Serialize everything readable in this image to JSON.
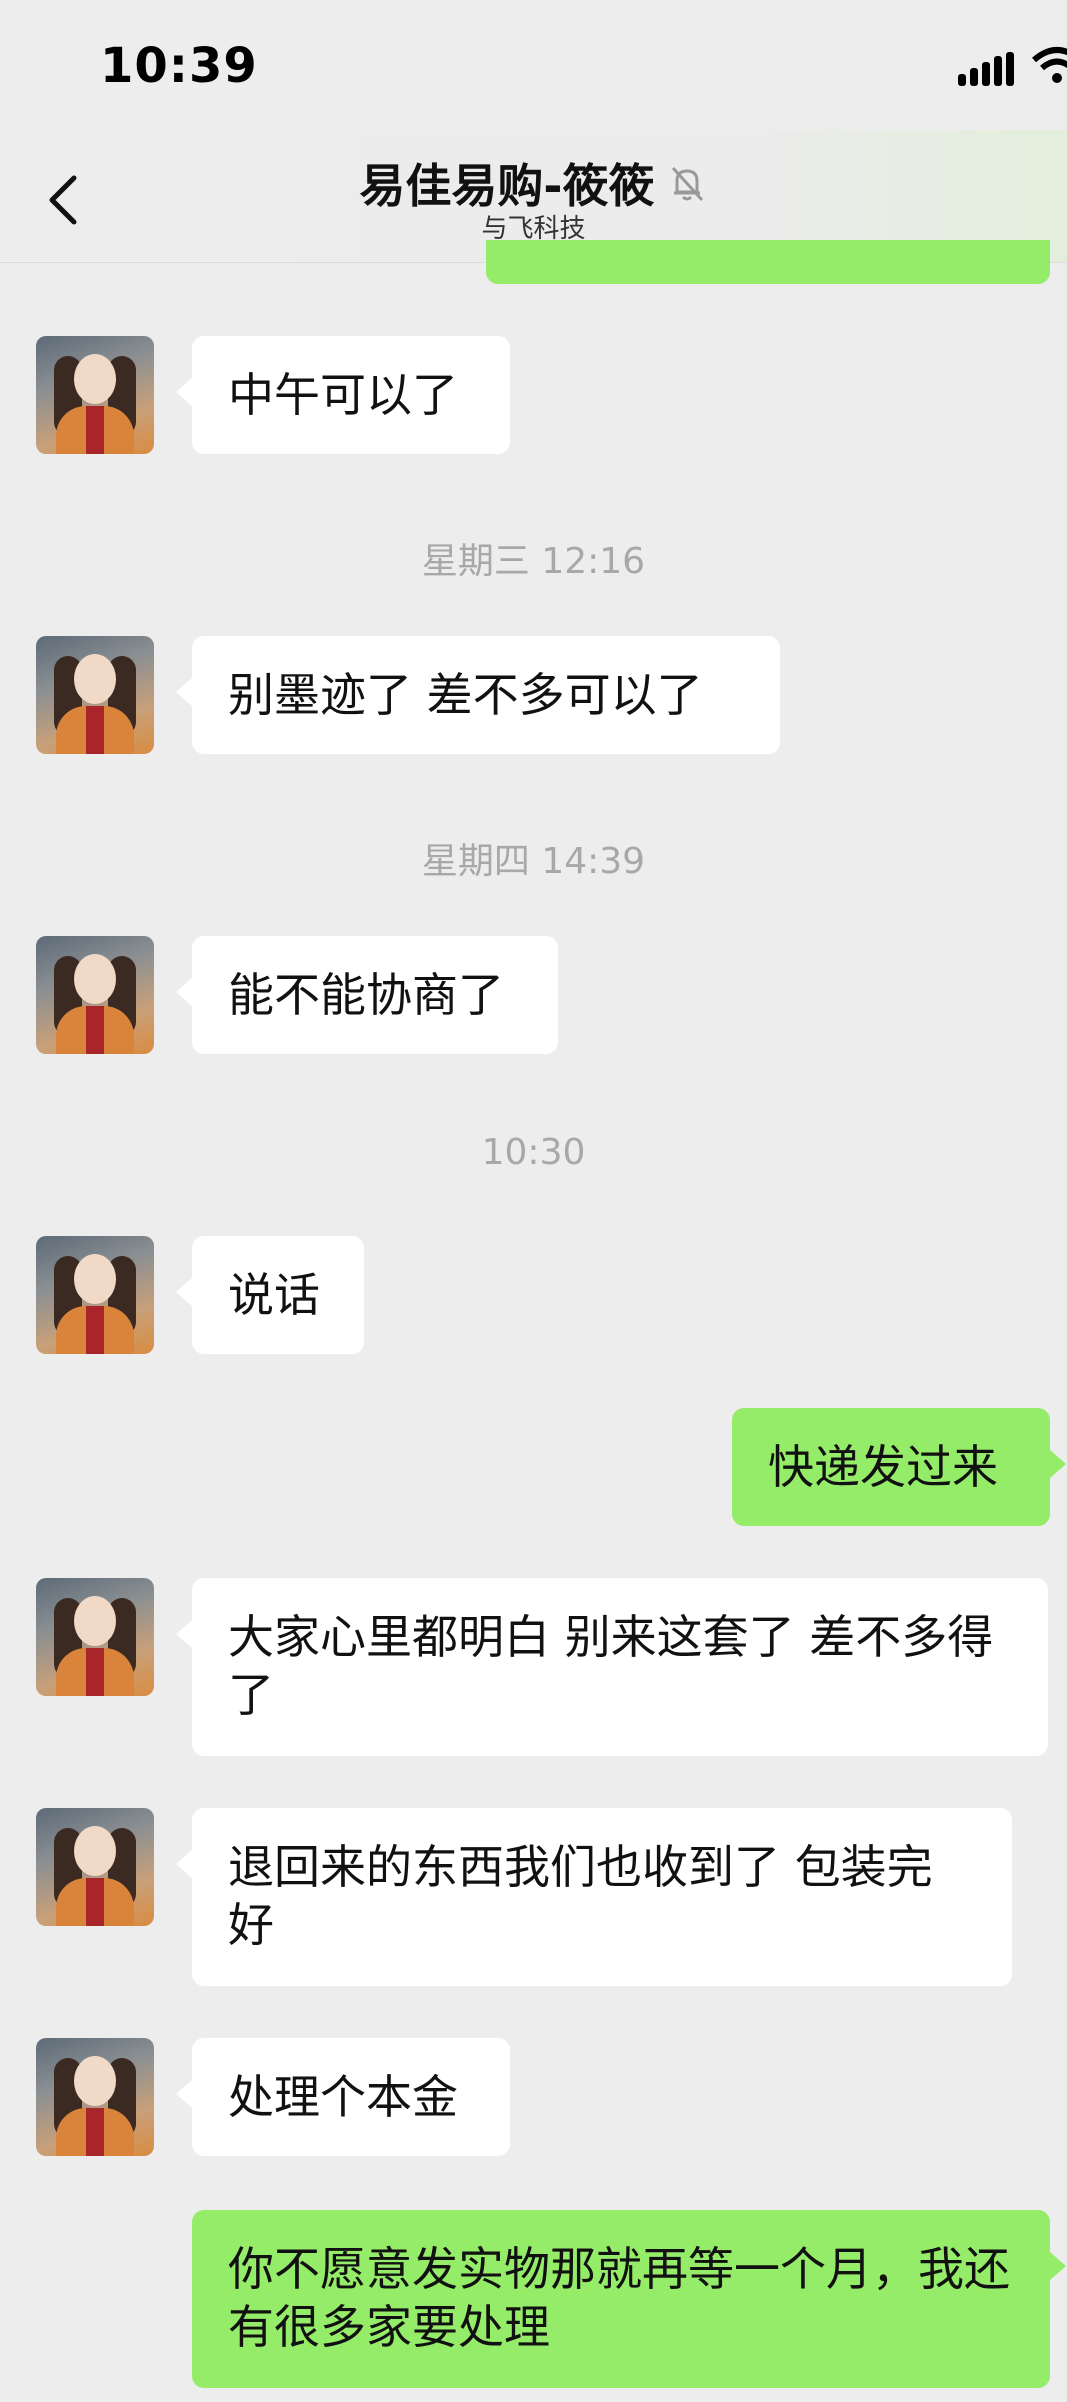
{
  "status_bar": {
    "time": "10:39"
  },
  "header": {
    "title": "易佳易购-筱筱",
    "subtitle": "与飞科技"
  },
  "messages": [
    {
      "side": "left",
      "text": "中午可以了"
    },
    {
      "type": "timestamp",
      "text": "星期三 12:16"
    },
    {
      "side": "left",
      "text": "别墨迹了  差不多可以了"
    },
    {
      "type": "timestamp",
      "text": "星期四 14:39"
    },
    {
      "side": "left",
      "text": "能不能协商了"
    },
    {
      "type": "timestamp",
      "text": "10:30"
    },
    {
      "side": "left",
      "text": "说话"
    },
    {
      "side": "right",
      "text": "快递发过来"
    },
    {
      "side": "left",
      "text": "大家心里都明白  别来这套了  差不多得了"
    },
    {
      "side": "left",
      "text": "退回来的东西我们也收到了 包装完好"
    },
    {
      "side": "left",
      "text": "处理个本金"
    },
    {
      "side": "right",
      "text": "你不愿意发实物那就再等一个月，我还有很多家要处理"
    }
  ],
  "colors": {
    "background": "#ededed",
    "incoming_bubble": "#ffffff",
    "outgoing_bubble": "#95ec69",
    "timestamp": "#a8a8a8"
  },
  "icons": {
    "back": "chevron-left-icon",
    "mute": "bell-muted-icon",
    "signal": "cellular-signal-icon",
    "wifi": "wifi-icon"
  }
}
